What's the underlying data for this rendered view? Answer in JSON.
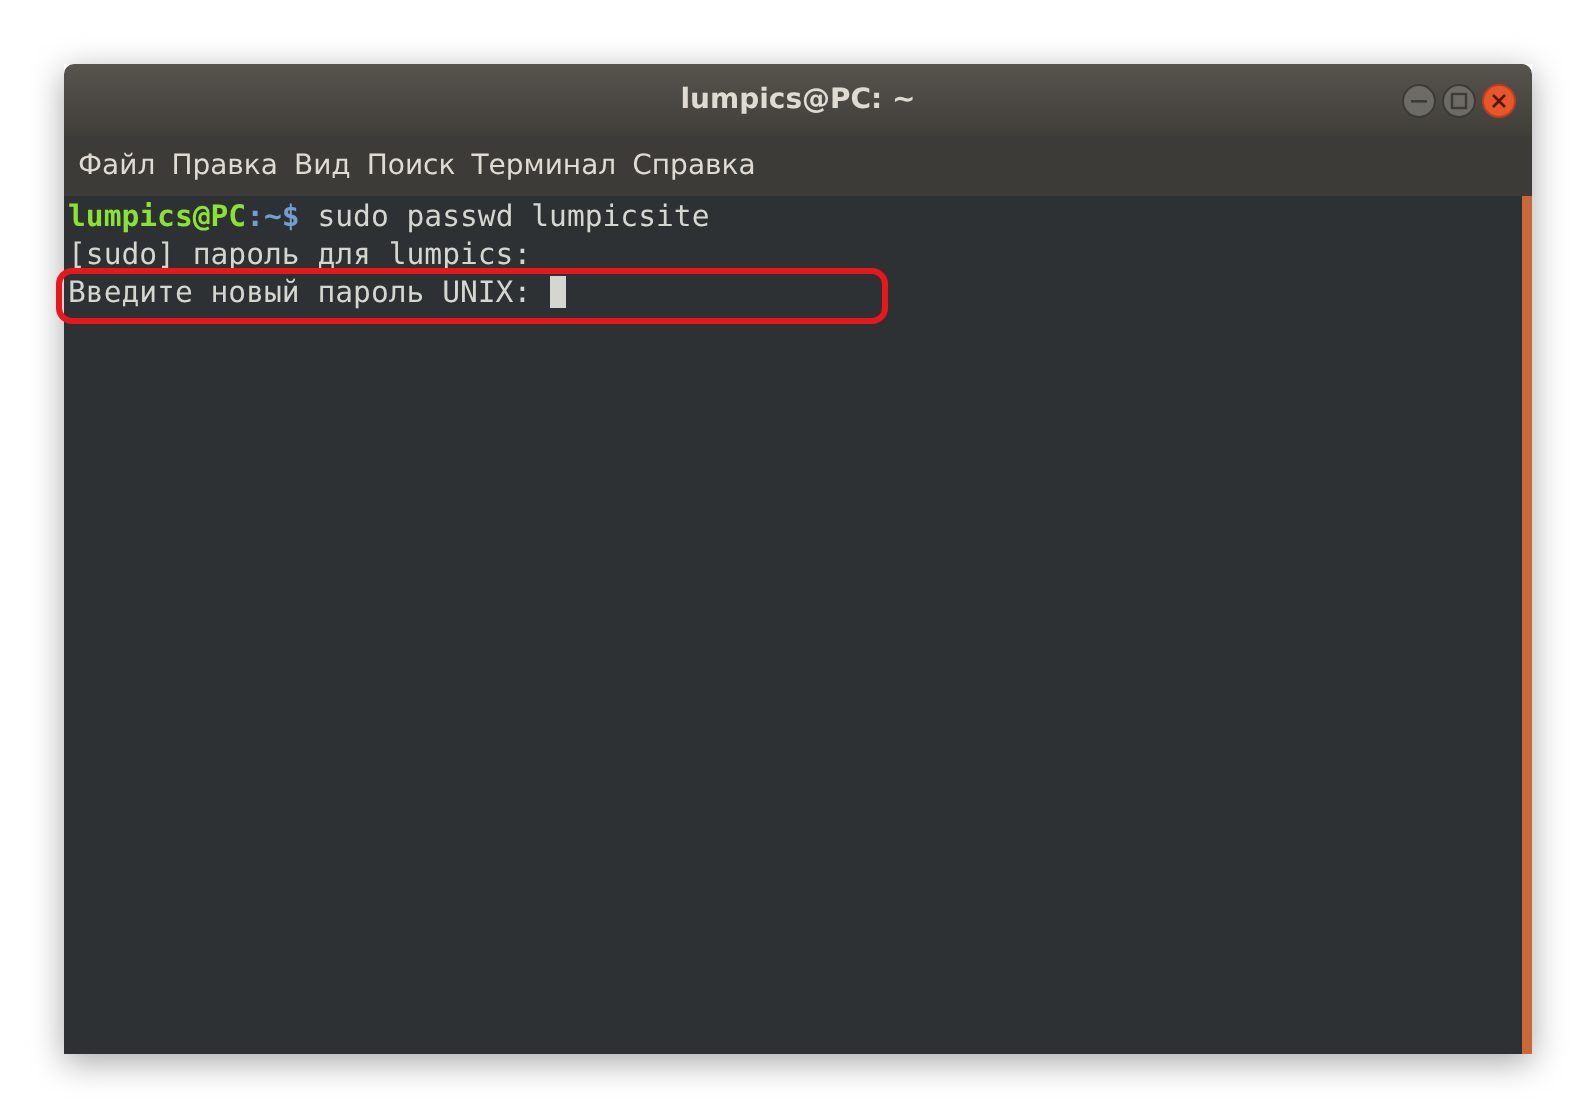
{
  "window": {
    "title": "lumpics@PC: ~"
  },
  "menu": [
    "Файл",
    "Правка",
    "Вид",
    "Поиск",
    "Терминал",
    "Справка"
  ],
  "terminal": {
    "lines": [
      {
        "kind": "prompt",
        "user": "lumpics@PC",
        "path": ":~$",
        "text": " sudo passwd lumpicsite",
        "highlighted": false,
        "cursor": false
      },
      {
        "kind": "output",
        "text": "[sudo] пароль для lumpics:",
        "highlighted": false,
        "cursor": false
      },
      {
        "kind": "output",
        "text": "Введите новый пароль UNIX: ",
        "highlighted": true,
        "cursor": true
      }
    ]
  }
}
